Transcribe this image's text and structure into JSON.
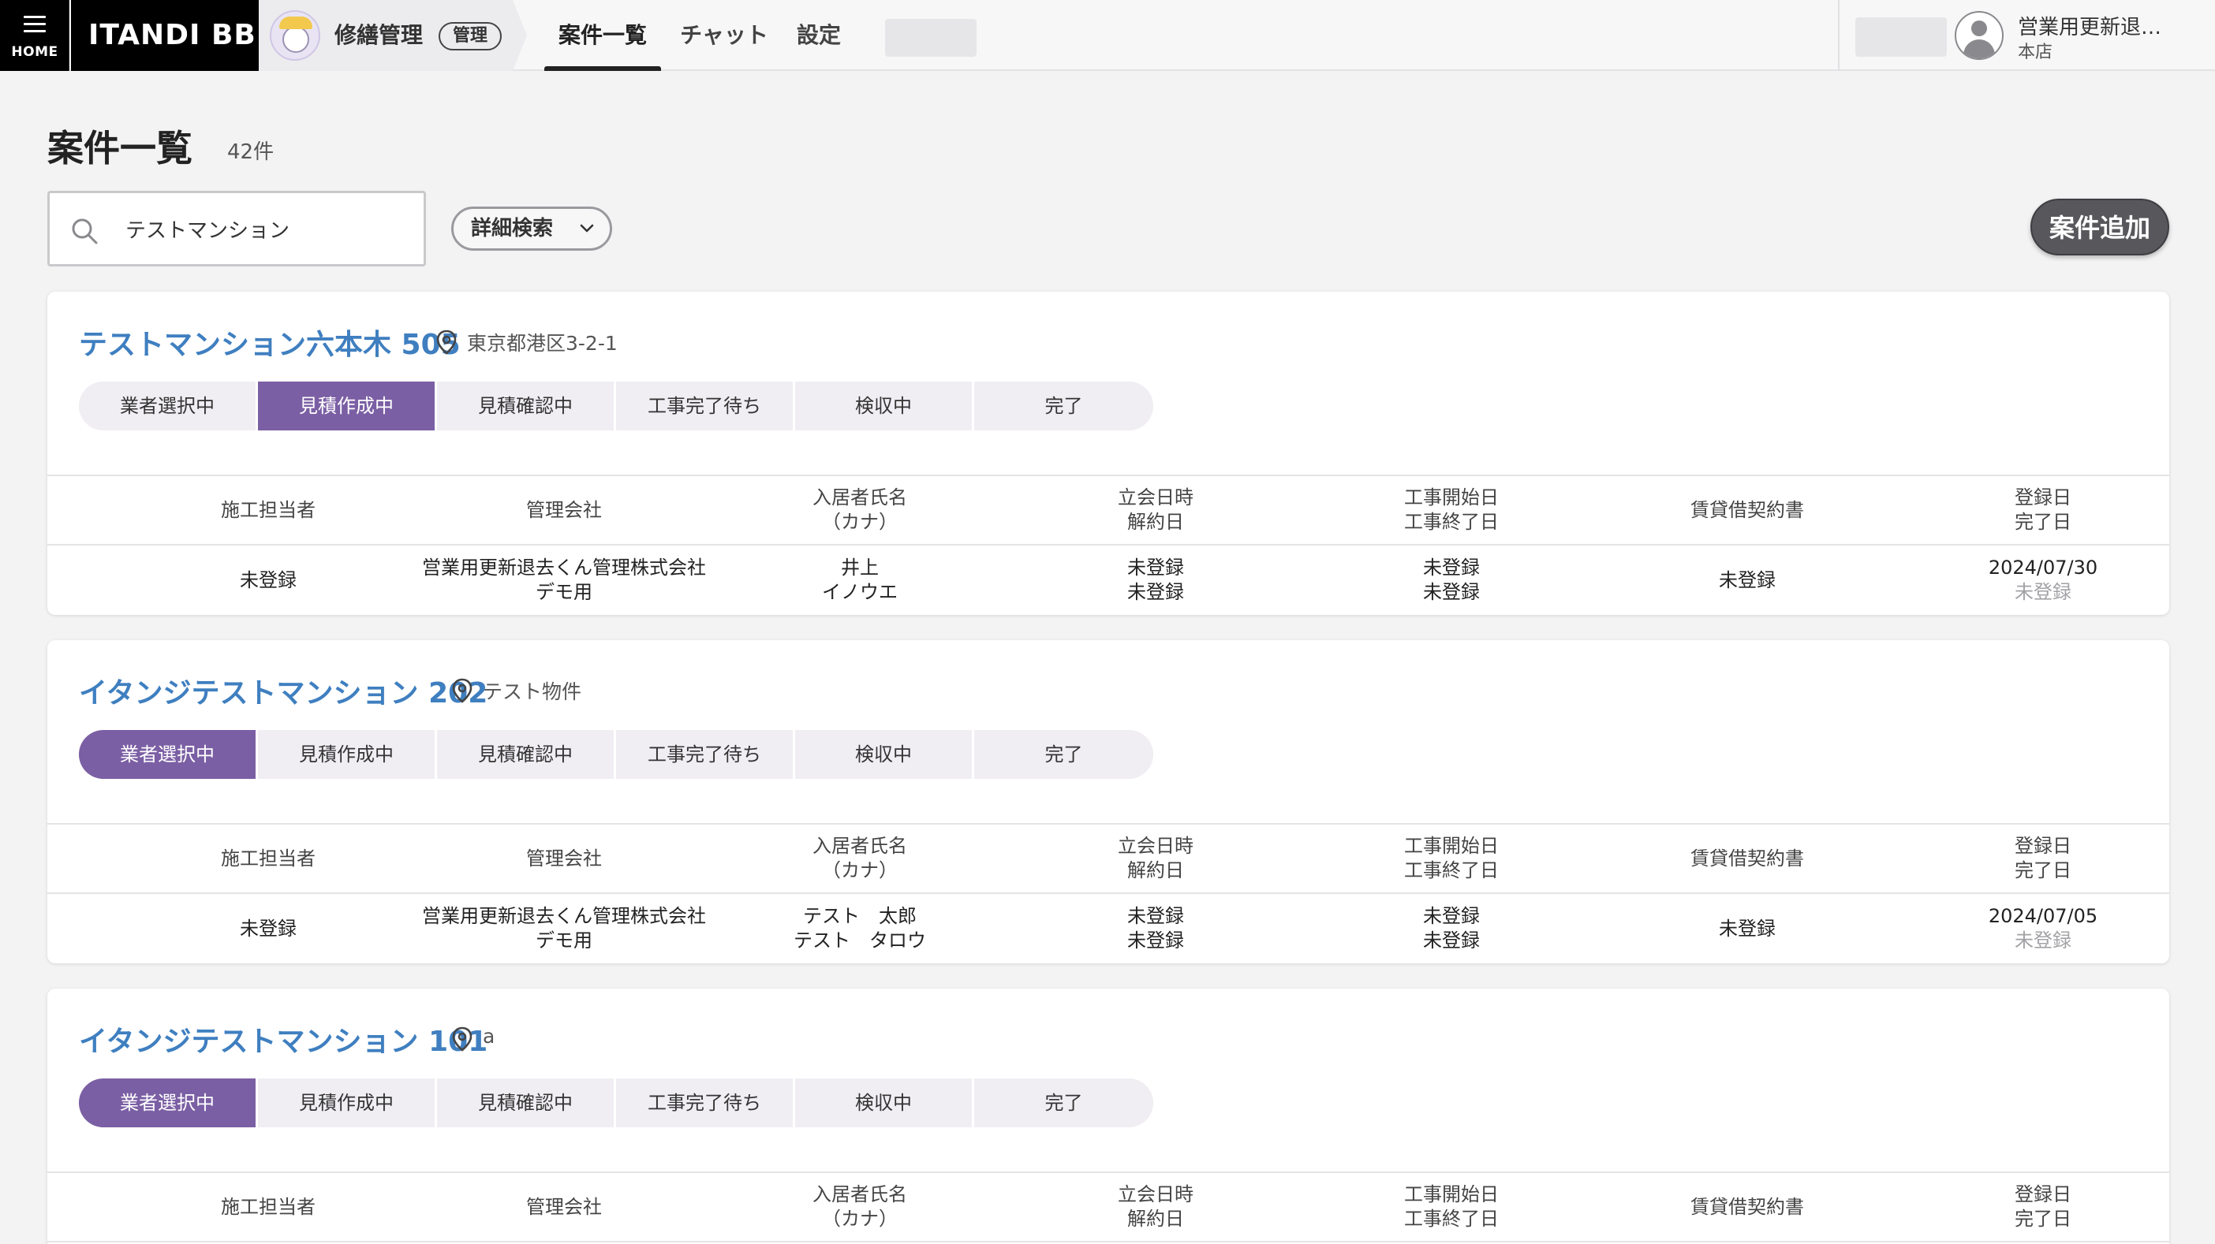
{
  "header": {
    "home_label": "HOME",
    "brand": "ITANDI BB",
    "app_title": "修繕管理",
    "app_badge": "管理",
    "nav": [
      {
        "label": "案件一覧",
        "active": true
      },
      {
        "label": "チャット",
        "active": false
      },
      {
        "label": "設定",
        "active": false
      }
    ],
    "user_name": "営業用更新退…",
    "user_branch": "本店"
  },
  "page": {
    "title": "案件一覧",
    "count": "42件"
  },
  "search": {
    "value": "テストマンション",
    "advanced_label": "詳細検索"
  },
  "add_button": "案件追加",
  "columns": [
    [
      "施工担当者"
    ],
    [
      "管理会社"
    ],
    [
      "入居者氏名",
      "（カナ）"
    ],
    [
      "立会日時",
      "解約日"
    ],
    [
      "工事開始日",
      "工事終了日"
    ],
    [
      "賃貸借契約書"
    ],
    [
      "登録日",
      "完了日"
    ]
  ],
  "steps": [
    "業者選択中",
    "見積作成中",
    "見積確認中",
    "工事完了待ち",
    "検収中",
    "完了"
  ],
  "cases": [
    {
      "title": "テストマンション六本木 505",
      "address": "東京都港区3-2-1",
      "active_step": 1,
      "row": {
        "contractor": "未登録",
        "company": [
          "営業用更新退去くん管理株式会社",
          "デモ用"
        ],
        "tenant": [
          "井上",
          "イノウエ"
        ],
        "inspection": [
          "未登録",
          "未登録"
        ],
        "construction": [
          "未登録",
          "未登録"
        ],
        "lease": "未登録",
        "dates": [
          "2024/07/30",
          "未登録"
        ]
      }
    },
    {
      "title": "イタンジテストマンション 202",
      "address": "テスト物件",
      "active_step": 0,
      "row": {
        "contractor": "未登録",
        "company": [
          "営業用更新退去くん管理株式会社",
          "デモ用"
        ],
        "tenant": [
          "テスト　太郎",
          "テスト　タロウ"
        ],
        "inspection": [
          "未登録",
          "未登録"
        ],
        "construction": [
          "未登録",
          "未登録"
        ],
        "lease": "未登録",
        "dates": [
          "2024/07/05",
          "未登録"
        ]
      }
    },
    {
      "title": "イタンジテストマンション 101",
      "address": "a",
      "active_step": 0
    }
  ],
  "colors": {
    "accent_purple": "#7b5fa4",
    "title_blue": "#3f7fc0",
    "dark_button": "#58585c"
  }
}
